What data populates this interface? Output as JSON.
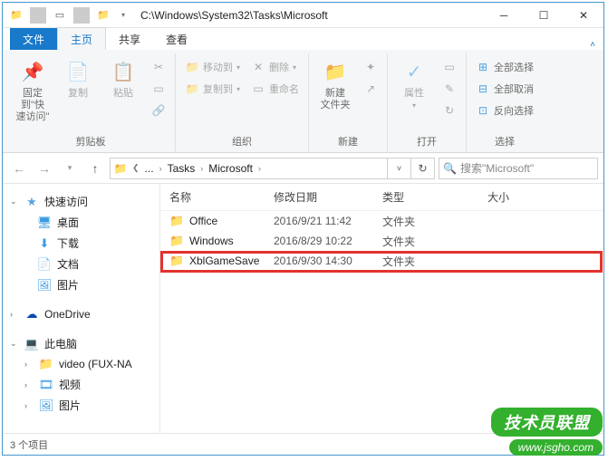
{
  "title": "C:\\Windows\\System32\\Tasks\\Microsoft",
  "tabs": {
    "file": "文件",
    "home": "主页",
    "share": "共享",
    "view": "查看"
  },
  "ribbon": {
    "pin": "固定到\"快\n速访问\"",
    "copy": "复制",
    "paste": "粘贴",
    "clipboard_label": "剪贴板",
    "moveto": "移动到",
    "copyto": "复制到",
    "delete": "删除",
    "rename": "重命名",
    "organize_label": "组织",
    "newfolder": "新建\n文件夹",
    "new_label": "新建",
    "properties": "属性",
    "open_label": "打开",
    "selectall": "全部选择",
    "selectnone": "全部取消",
    "invert": "反向选择",
    "select_label": "选择"
  },
  "breadcrumbs": {
    "a": "...",
    "b": "Tasks",
    "c": "Microsoft"
  },
  "search_placeholder": "搜索\"Microsoft\"",
  "side": {
    "quick": "快速访问",
    "desktop": "桌面",
    "downloads": "下载",
    "documents": "文档",
    "pictures": "图片",
    "onedrive": "OneDrive",
    "thispc": "此电脑",
    "video": "video (FUX-NA",
    "videos": "视频",
    "pictures2": "图片"
  },
  "columns": {
    "name": "名称",
    "date": "修改日期",
    "type": "类型",
    "size": "大小"
  },
  "rows": [
    {
      "name": "Office",
      "date": "2016/9/21 11:42",
      "type": "文件夹"
    },
    {
      "name": "Windows",
      "date": "2016/8/29 10:22",
      "type": "文件夹"
    },
    {
      "name": "XblGameSave",
      "date": "2016/9/30 14:30",
      "type": "文件夹"
    }
  ],
  "status": "3 个项目",
  "watermark": {
    "line1": "技术员联盟",
    "line2": "www.jsgho.com"
  }
}
